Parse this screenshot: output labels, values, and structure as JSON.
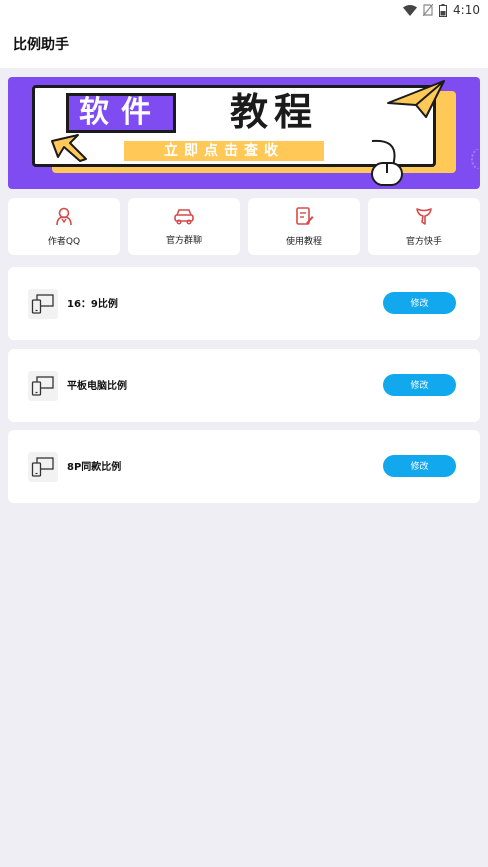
{
  "status": {
    "time": "4:10",
    "icons": [
      "wifi-icon",
      "no-sim-icon",
      "battery-icon"
    ]
  },
  "appbar": {
    "title": "比例助手"
  },
  "banner": {
    "title_left": "软件",
    "title_right": "教程",
    "cta": "立即点击查收",
    "colors": {
      "purple": "#7e4cf0",
      "yellow": "#ffc857"
    }
  },
  "quick_actions": [
    {
      "label": "作者QQ",
      "icon": "person-icon"
    },
    {
      "label": "官方群聊",
      "icon": "car-icon"
    },
    {
      "label": "使用教程",
      "icon": "document-edit-icon"
    },
    {
      "label": "官方快手",
      "icon": "kuaishou-icon"
    }
  ],
  "presets": [
    {
      "name": "16：9比例",
      "action": "修改",
      "icon": "devices-icon"
    },
    {
      "name": "平板电脑比例",
      "action": "修改",
      "icon": "devices-icon"
    },
    {
      "name": "8P同款比例",
      "action": "修改",
      "icon": "devices-icon"
    }
  ],
  "colors": {
    "accent": "#12a8ee",
    "icon_red": "#d84a4a",
    "background": "#efeef4"
  }
}
